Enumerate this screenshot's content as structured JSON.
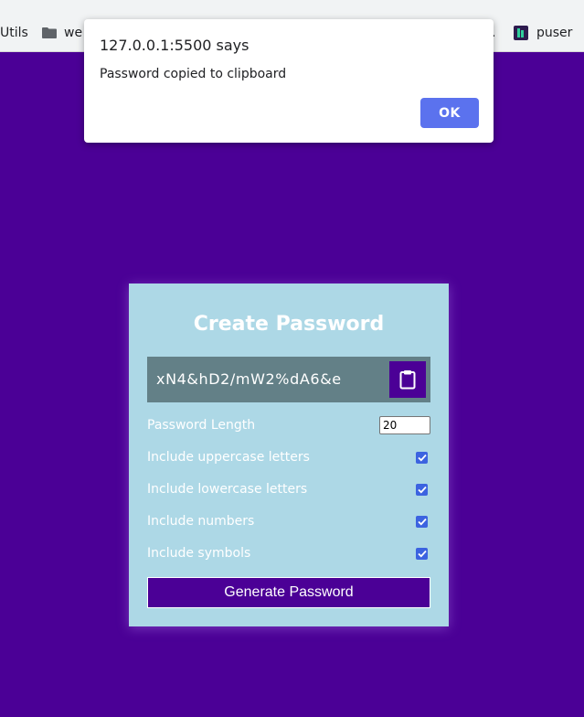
{
  "bookmarks": [
    {
      "label": "Utils"
    },
    {
      "label": "we",
      "icon": "folder-icon"
    },
    {
      "label": "."
    },
    {
      "label": "puser",
      "icon": "puser-icon"
    }
  ],
  "alert": {
    "title": "127.0.0.1:5500 says",
    "message": "Password copied to clipboard",
    "ok_label": "OK"
  },
  "card": {
    "title": "Create Password",
    "password": "xN4&hD2/mW2%dA6&e",
    "clipboard_icon": "clipboard-icon",
    "length_label": "Password Length",
    "length_value": "20",
    "options": [
      {
        "label": "Include uppercase letters",
        "checked": true
      },
      {
        "label": "Include lowercase letters",
        "checked": true
      },
      {
        "label": "Include numbers",
        "checked": true
      },
      {
        "label": "Include symbols",
        "checked": true
      }
    ],
    "generate_label": "Generate Password"
  },
  "colors": {
    "page_bg": "#4b0096",
    "card_bg": "#add8e6",
    "result_bg": "#638087",
    "accent": "#4b0096",
    "ok_button": "#5b72ee"
  }
}
